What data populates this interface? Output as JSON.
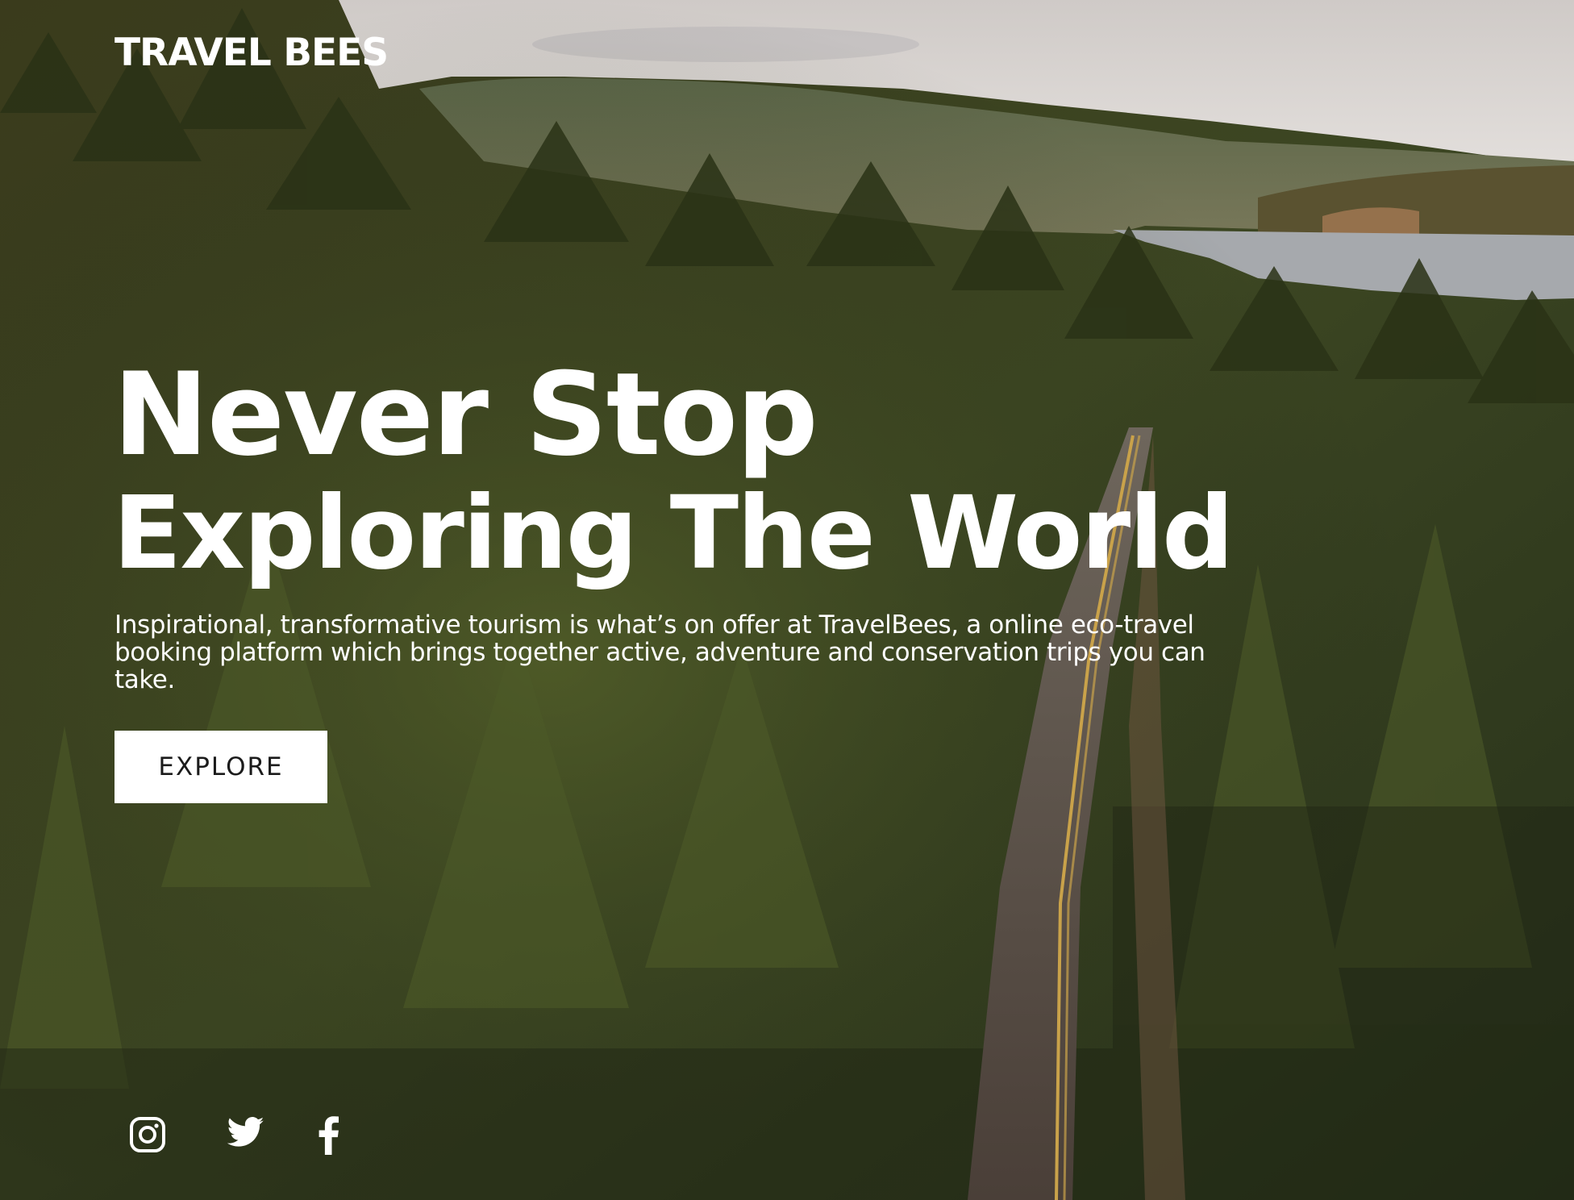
{
  "site": {
    "brand": "TRAVEL BEES"
  },
  "hero": {
    "headline_line1": "Never Stop",
    "headline_line2": "Exploring The World",
    "description": "Inspirational, transformative tourism is what’s on offer at TravelBees, a online eco-travel booking platform which brings together active, adventure and conservation trips you can take.",
    "cta_label": "EXPLORE"
  },
  "social": [
    {
      "name": "Instagram",
      "icon": "instagram-icon"
    },
    {
      "name": "Twitter",
      "icon": "twitter-icon"
    },
    {
      "name": "Facebook",
      "icon": "facebook-icon"
    }
  ],
  "colors": {
    "text": "#ffffff",
    "button_bg": "#ffffff",
    "button_text": "#1b1b1b",
    "sky": "#d9d6d5",
    "forest": "#2d3a1c",
    "road": "#5a4a40",
    "lake": "#a6a9ad"
  }
}
